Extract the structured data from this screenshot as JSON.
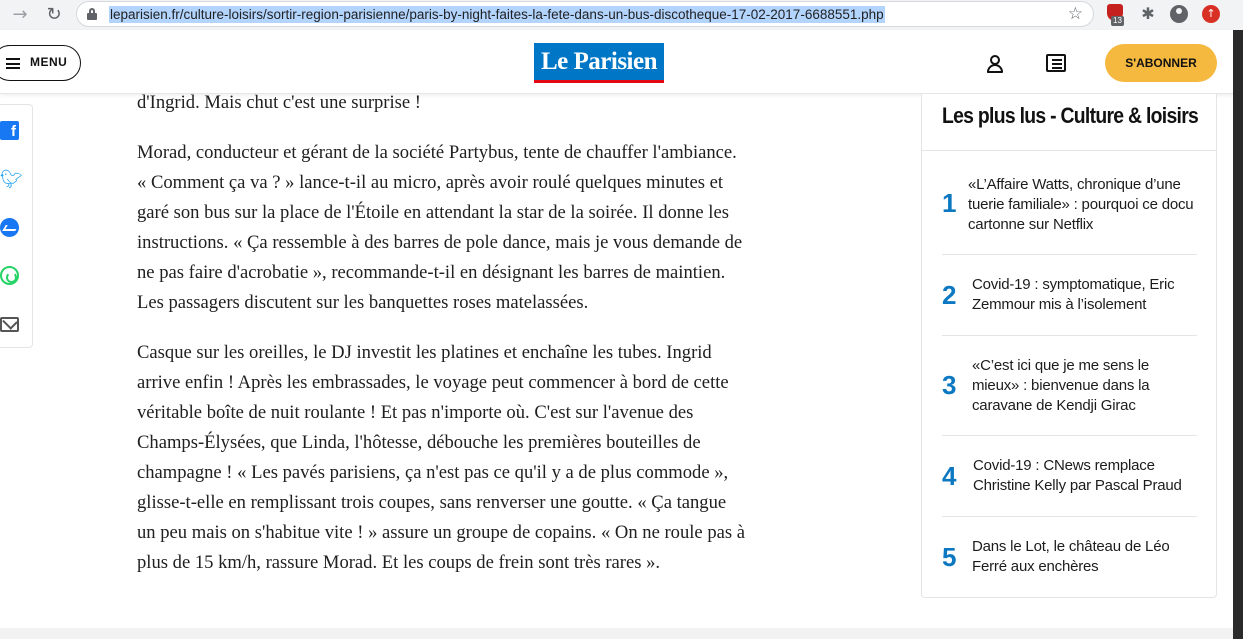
{
  "browser": {
    "url": "leparisien.fr/culture-loisirs/sortir-region-parisienne/paris-by-night-faites-la-fete-dans-un-bus-discotheque-17-02-2017-6688551.php",
    "extension_badge_count": "13",
    "icons": [
      "forward-arrow-icon",
      "reload-icon",
      "lock-icon",
      "bookmark-star-icon",
      "ublock-icon",
      "puzzle-icon",
      "profile-icon",
      "update-icon"
    ]
  },
  "header": {
    "menu_label": "MENU",
    "logo_text": "Le Parisien",
    "subscribe_label": "S'ABONNER",
    "colors": {
      "logo_blue": "#0077c6",
      "logo_red": "#e30613",
      "subscribe_yellow": "#f5b940"
    }
  },
  "share": {
    "icons": [
      "facebook-icon",
      "twitter-icon",
      "messenger-icon",
      "whatsapp-icon",
      "email-icon"
    ],
    "facebook_glyph": "f"
  },
  "article": {
    "paragraphs": [
      "d'Ingrid. Mais chut c'est une surprise !",
      "Morad, conducteur et gérant de la société Partybus, tente de chauffer l'ambiance. « Comment ça va ? » lance-t-il au micro, après avoir roulé quelques minutes et garé son bus sur la place de l'Étoile en attendant la star de la soirée. Il donne les instructions. « Ça ressemble à des barres de pole dance, mais je vous demande de ne pas faire d'acrobatie », recommande-t-il en désignant les barres de maintien. Les passagers discutent sur les banquettes roses matelassées.",
      "Casque sur les oreilles, le DJ investit les platines et enchaîne les tubes. Ingrid arrive enfin ! Après les embrassades, le voyage peut commencer à bord de cette véritable boîte de nuit roulante ! Et pas n'importe où. C'est sur l'avenue des Champs-Élysées, que Linda, l'hôtesse, débouche les premières bouteilles de champagne ! « Les pavés parisiens, ça n'est pas ce qu'il y a de plus commode », glisse-t-elle en remplissant trois coupes, sans renverser une goutte. « Ça tangue un peu mais on s'habitue vite ! » assure un groupe de copains. « On ne roule pas à plus de 15 km/h, rassure Morad. Et les coups de frein sont très rares »."
    ]
  },
  "most_read": {
    "title": "Les plus lus - Culture & loisirs",
    "accent_color": "#0c78c2",
    "items": [
      {
        "rank": "1",
        "text": "«L’Affaire Watts, chronique d’une tuerie familiale» : pourquoi ce docu cartonne sur Netflix"
      },
      {
        "rank": "2",
        "text": "Covid-19 : symptomatique, Eric Zemmour mis à l’isolement"
      },
      {
        "rank": "3",
        "text": "«C’est ici que je me sens le mieux» : bienvenue dans la caravane de Kendji Girac"
      },
      {
        "rank": "4",
        "text": "Covid-19 : CNews remplace Christine Kelly par Pascal Praud"
      },
      {
        "rank": "5",
        "text": "Dans le Lot, le château de Léo Ferré aux enchères"
      }
    ]
  }
}
